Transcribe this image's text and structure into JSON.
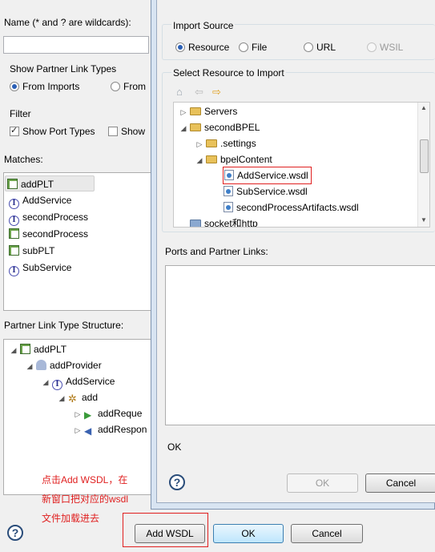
{
  "main": {
    "name_label": "Name (* and ? are wildcards):",
    "show_partner_group": "Show Partner Link Types",
    "radio_from_imports": "From Imports",
    "radio_from_other": "From",
    "filter_group": "Filter",
    "check_show_port_types": "Show Port Types",
    "check_show_other": "Show",
    "matches_label": "Matches:",
    "matches": [
      {
        "icon": "partner-link-type-icon",
        "label": "addPLT"
      },
      {
        "icon": "interface-icon",
        "label": "AddService"
      },
      {
        "icon": "interface-icon",
        "label": "secondProcess"
      },
      {
        "icon": "partner-link-type-icon",
        "label": "secondProcess"
      },
      {
        "icon": "partner-link-type-icon",
        "label": "subPLT"
      },
      {
        "icon": "interface-icon",
        "label": "SubService"
      }
    ],
    "structure_label": "Partner Link Type Structure:",
    "structure": [
      {
        "label": "addPLT"
      },
      {
        "label": "addProvider"
      },
      {
        "label": "AddService"
      },
      {
        "label": "add"
      },
      {
        "label": "addReque"
      },
      {
        "label": "addRespon"
      }
    ],
    "note_lines": [
      "点击Add WSDL，在",
      "新窗口把对应的wsdl",
      "文件加载进去"
    ],
    "add_wsdl": "Add WSDL",
    "ok": "OK",
    "cancel": "Cancel"
  },
  "dialog": {
    "import_source_group": "Import Source",
    "radio_resource": "Resource",
    "radio_file": "File",
    "radio_url": "URL",
    "radio_wsil": "WSIL",
    "select_label": "Select Resource to Import",
    "tree": [
      {
        "label": "Servers"
      },
      {
        "label": "secondBPEL"
      },
      {
        "label": ".settings"
      },
      {
        "label": "bpelContent"
      },
      {
        "label": "AddService.wsdl"
      },
      {
        "label": "SubService.wsdl"
      },
      {
        "label": "secondProcessArtifacts.wsdl"
      },
      {
        "label": "socket和http"
      }
    ],
    "ports_label": "Ports and Partner Links:",
    "status": "OK",
    "ok": "OK",
    "cancel": "Cancel"
  },
  "colors": {
    "accent": "#3c7fb1",
    "annotation": "#e02020",
    "selection": "#cde8ff"
  }
}
